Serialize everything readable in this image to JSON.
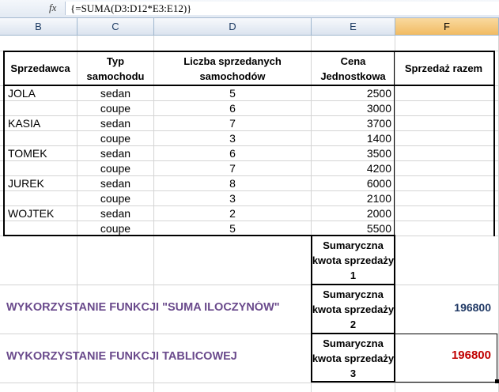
{
  "formula_bar": {
    "fx_label": "fx",
    "formula": "{=SUMA(D3:D12*E3:E12)}"
  },
  "columns": [
    "B",
    "C",
    "D",
    "E",
    "F"
  ],
  "selected_column": "F",
  "table": {
    "headers": {
      "seller": "Sprzedawca",
      "type": "Typ samochodu",
      "count": "Liczba sprzedanych samochodów",
      "price": "Cena Jednostkowa",
      "total": "Sprzedaż razem"
    },
    "rows": [
      {
        "seller": "JOLA",
        "type": "sedan",
        "count": "5",
        "price": "2500"
      },
      {
        "seller": "",
        "type": "coupe",
        "count": "6",
        "price": "3000"
      },
      {
        "seller": "KASIA",
        "type": "sedan",
        "count": "7",
        "price": "3700"
      },
      {
        "seller": "",
        "type": "coupe",
        "count": "3",
        "price": "1400"
      },
      {
        "seller": "TOMEK",
        "type": "sedan",
        "count": "6",
        "price": "3500"
      },
      {
        "seller": "",
        "type": "coupe",
        "count": "7",
        "price": "4200"
      },
      {
        "seller": "JUREK",
        "type": "sedan",
        "count": "8",
        "price": "6000"
      },
      {
        "seller": "",
        "type": "coupe",
        "count": "3",
        "price": "2100"
      },
      {
        "seller": "WOJTEK",
        "type": "sedan",
        "count": "2",
        "price": "2000"
      },
      {
        "seller": "",
        "type": "coupe",
        "count": "5",
        "price": "5500"
      }
    ]
  },
  "summary": {
    "label1": "Sumaryczna kwota sprzedaży 1",
    "label2": "Sumaryczna kwota sprzedaży 2",
    "label3": "Sumaryczna kwota sprzedaży 3",
    "value2": "196800",
    "value3": "196800",
    "caption2": "WYKORZYSTANIE FUNKCJI \"SUMA ILOCZYNÓW\"",
    "caption3": "WYKORZYSTANIE FUNKCJI TABLICOWEJ"
  },
  "colors": {
    "caption": "#6a4a8c",
    "value2": "#1f3864",
    "value3": "#c00000"
  }
}
